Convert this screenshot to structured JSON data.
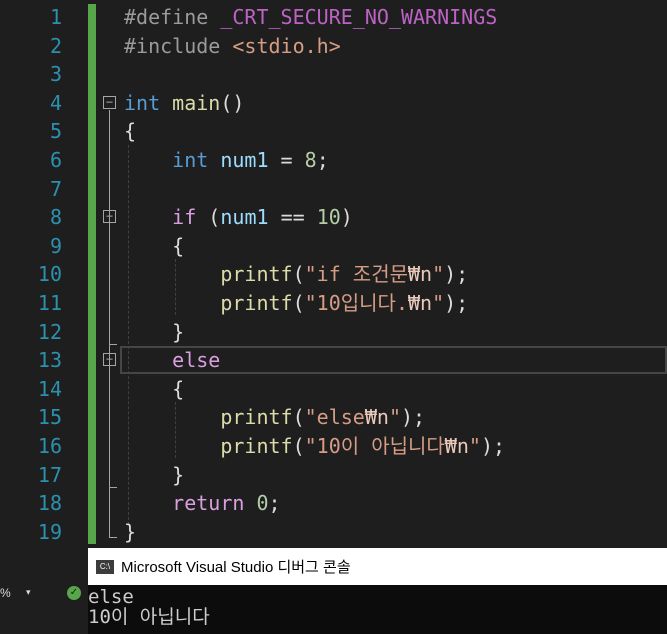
{
  "editor": {
    "line_numbers": [
      "1",
      "2",
      "3",
      "4",
      "5",
      "6",
      "7",
      "8",
      "9",
      "10",
      "11",
      "12",
      "13",
      "14",
      "15",
      "16",
      "17",
      "18",
      "19"
    ],
    "lines": [
      [
        {
          "t": "#define ",
          "c": "pp"
        },
        {
          "t": "_CRT_SECURE_NO_WARNINGS",
          "c": "macro"
        }
      ],
      [
        {
          "t": "#include ",
          "c": "pp"
        },
        {
          "t": "<stdio.h>",
          "c": "inc"
        }
      ],
      [],
      [
        {
          "t": "int ",
          "c": "kw"
        },
        {
          "t": "main",
          "c": "fn"
        },
        {
          "t": "()",
          "c": "pl"
        }
      ],
      [
        {
          "t": "{",
          "c": "pl"
        }
      ],
      [
        {
          "t": "    ",
          "c": "pl"
        },
        {
          "t": "int ",
          "c": "kw"
        },
        {
          "t": "num1",
          "c": "var"
        },
        {
          "t": " = ",
          "c": "pl"
        },
        {
          "t": "8",
          "c": "num"
        },
        {
          "t": ";",
          "c": "pl"
        }
      ],
      [],
      [
        {
          "t": "    ",
          "c": "pl"
        },
        {
          "t": "if",
          "c": "ctl"
        },
        {
          "t": " (",
          "c": "pl"
        },
        {
          "t": "num1",
          "c": "var"
        },
        {
          "t": " == ",
          "c": "pl"
        },
        {
          "t": "10",
          "c": "num"
        },
        {
          "t": ")",
          "c": "pl"
        }
      ],
      [
        {
          "t": "    {",
          "c": "pl"
        }
      ],
      [
        {
          "t": "        ",
          "c": "pl"
        },
        {
          "t": "printf",
          "c": "fn"
        },
        {
          "t": "(",
          "c": "pl"
        },
        {
          "t": "\"if 조건문",
          "c": "str"
        },
        {
          "t": "₩n",
          "c": "esc"
        },
        {
          "t": "\"",
          "c": "str"
        },
        {
          "t": ");",
          "c": "pl"
        }
      ],
      [
        {
          "t": "        ",
          "c": "pl"
        },
        {
          "t": "printf",
          "c": "fn"
        },
        {
          "t": "(",
          "c": "pl"
        },
        {
          "t": "\"10입니다.",
          "c": "str"
        },
        {
          "t": "₩n",
          "c": "esc"
        },
        {
          "t": "\"",
          "c": "str"
        },
        {
          "t": ");",
          "c": "pl"
        }
      ],
      [
        {
          "t": "    }",
          "c": "pl"
        }
      ],
      [
        {
          "t": "    ",
          "c": "pl"
        },
        {
          "t": "else",
          "c": "ctl"
        }
      ],
      [
        {
          "t": "    {",
          "c": "pl"
        }
      ],
      [
        {
          "t": "        ",
          "c": "pl"
        },
        {
          "t": "printf",
          "c": "fn"
        },
        {
          "t": "(",
          "c": "pl"
        },
        {
          "t": "\"else",
          "c": "str"
        },
        {
          "t": "₩n",
          "c": "esc"
        },
        {
          "t": "\"",
          "c": "str"
        },
        {
          "t": ");",
          "c": "pl"
        }
      ],
      [
        {
          "t": "        ",
          "c": "pl"
        },
        {
          "t": "printf",
          "c": "fn"
        },
        {
          "t": "(",
          "c": "pl"
        },
        {
          "t": "\"10이 아닙니다",
          "c": "str"
        },
        {
          "t": "₩n",
          "c": "esc"
        },
        {
          "t": "\"",
          "c": "str"
        },
        {
          "t": ");",
          "c": "pl"
        }
      ],
      [
        {
          "t": "    }",
          "c": "pl"
        }
      ],
      [
        {
          "t": "    ",
          "c": "pl"
        },
        {
          "t": "return ",
          "c": "ctl"
        },
        {
          "t": "0",
          "c": "num"
        },
        {
          "t": ";",
          "c": "pl"
        }
      ],
      [
        {
          "t": "}",
          "c": "pl"
        }
      ]
    ],
    "fold_markers": [
      "−",
      "−",
      "−"
    ]
  },
  "console": {
    "title": "Microsoft Visual Studio 디버그 콘솔",
    "icon_label": "C:\\",
    "output": [
      "else",
      "10이 아닙니다"
    ]
  },
  "status": {
    "zoom": "%",
    "zoom_arrow": "▾",
    "ok_icon": "✓"
  },
  "colors": {
    "background": "#1e1e1e",
    "line_number": "#2b91af",
    "keyword": "#569cd6",
    "control": "#d8a0df",
    "function": "#dcdcaa",
    "variable": "#9cdcfe",
    "number": "#b5cea8",
    "string": "#d69d85",
    "change_bar": "#57a64a"
  }
}
